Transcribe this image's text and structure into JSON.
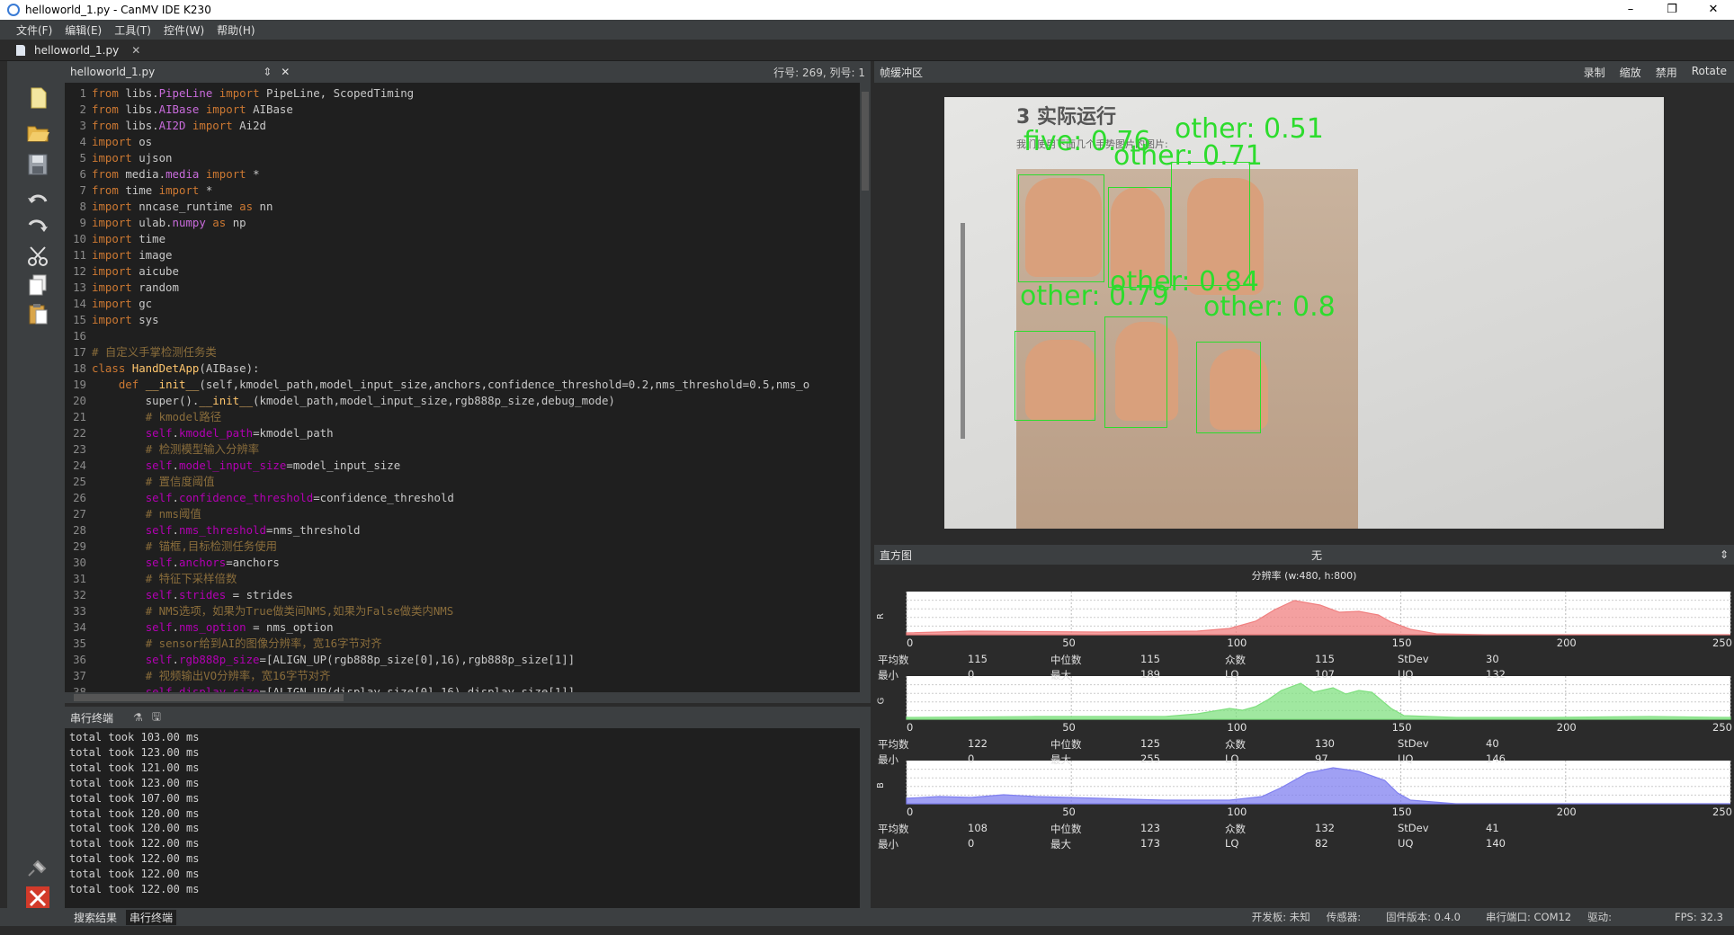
{
  "window": {
    "title": "helloworld_1.py - CanMV IDE K230",
    "minimize": "–",
    "maximize": "❐",
    "close": "✕"
  },
  "menu": [
    "文件(F)",
    "编辑(E)",
    "工具(T)",
    "控件(W)",
    "帮助(H)"
  ],
  "file_tab": {
    "label": "helloworld_1.py",
    "close": "✕"
  },
  "editor": {
    "filename": "helloworld_1.py",
    "switch": "⇕",
    "close": "✕",
    "cursor": "行号: 269, 列号: 1"
  },
  "code": [
    [
      [
        "kw",
        "from "
      ],
      [
        "pl",
        "libs."
      ],
      [
        "cl",
        "PipeLine"
      ],
      [
        "kw",
        " import "
      ],
      [
        "pl",
        "PipeLine, ScopedTiming"
      ]
    ],
    [
      [
        "kw",
        "from "
      ],
      [
        "pl",
        "libs."
      ],
      [
        "cl",
        "AIBase"
      ],
      [
        "kw",
        " import "
      ],
      [
        "pl",
        "AIBase"
      ]
    ],
    [
      [
        "kw",
        "from "
      ],
      [
        "pl",
        "libs."
      ],
      [
        "cl",
        "AI2D"
      ],
      [
        "kw",
        " import "
      ],
      [
        "pl",
        "Ai2d"
      ]
    ],
    [
      [
        "kw",
        "import "
      ],
      [
        "pl",
        "os"
      ]
    ],
    [
      [
        "kw",
        "import "
      ],
      [
        "pl",
        "ujson"
      ]
    ],
    [
      [
        "kw",
        "from "
      ],
      [
        "pl",
        "media."
      ],
      [
        "cl",
        "media"
      ],
      [
        "kw",
        " import "
      ],
      [
        "pl",
        "*"
      ]
    ],
    [
      [
        "kw",
        "from "
      ],
      [
        "pl",
        "time"
      ],
      [
        "kw",
        " import "
      ],
      [
        "pl",
        "*"
      ]
    ],
    [
      [
        "kw",
        "import "
      ],
      [
        "pl",
        "nncase_runtime"
      ],
      [
        "kw",
        " as "
      ],
      [
        "pl",
        "nn"
      ]
    ],
    [
      [
        "kw",
        "import "
      ],
      [
        "pl",
        "ulab."
      ],
      [
        "cl",
        "numpy"
      ],
      [
        "kw",
        " as "
      ],
      [
        "pl",
        "np"
      ]
    ],
    [
      [
        "kw",
        "import "
      ],
      [
        "pl",
        "time"
      ]
    ],
    [
      [
        "kw",
        "import "
      ],
      [
        "pl",
        "image"
      ]
    ],
    [
      [
        "kw",
        "import "
      ],
      [
        "pl",
        "aicube"
      ]
    ],
    [
      [
        "kw",
        "import "
      ],
      [
        "pl",
        "random"
      ]
    ],
    [
      [
        "kw",
        "import "
      ],
      [
        "pl",
        "gc"
      ]
    ],
    [
      [
        "kw",
        "import "
      ],
      [
        "pl",
        "sys"
      ]
    ],
    [
      [
        "pl",
        ""
      ]
    ],
    [
      [
        "cm",
        "# 自定义手掌检测任务类"
      ]
    ],
    [
      [
        "kw",
        "class "
      ],
      [
        "df",
        "HandDetApp"
      ],
      [
        "pl",
        "(AIBase):"
      ]
    ],
    [
      [
        "pl",
        "    "
      ],
      [
        "kw",
        "def "
      ],
      [
        "df",
        "__init__"
      ],
      [
        "pl",
        "(self,kmodel_path,model_input_size,anchors,confidence_threshold=0.2,nms_threshold=0.5,nms_o"
      ]
    ],
    [
      [
        "pl",
        "        super()."
      ],
      [
        "df",
        "__init__"
      ],
      [
        "pl",
        "(kmodel_path,model_input_size,rgb888p_size,debug_mode)"
      ]
    ],
    [
      [
        "pl",
        "        "
      ],
      [
        "cm",
        "# kmodel路径"
      ]
    ],
    [
      [
        "pl",
        "        "
      ],
      [
        "sf",
        "self"
      ],
      [
        "pl",
        "."
      ],
      [
        "sf",
        "kmodel_path"
      ],
      [
        "pl",
        "=kmodel_path"
      ]
    ],
    [
      [
        "pl",
        "        "
      ],
      [
        "cm",
        "# 检测模型输入分辨率"
      ]
    ],
    [
      [
        "pl",
        "        "
      ],
      [
        "sf",
        "self"
      ],
      [
        "pl",
        "."
      ],
      [
        "sf",
        "model_input_size"
      ],
      [
        "pl",
        "=model_input_size"
      ]
    ],
    [
      [
        "pl",
        "        "
      ],
      [
        "cm",
        "# 置信度阈值"
      ]
    ],
    [
      [
        "pl",
        "        "
      ],
      [
        "sf",
        "self"
      ],
      [
        "pl",
        "."
      ],
      [
        "sf",
        "confidence_threshold"
      ],
      [
        "pl",
        "=confidence_threshold"
      ]
    ],
    [
      [
        "pl",
        "        "
      ],
      [
        "cm",
        "# nms阈值"
      ]
    ],
    [
      [
        "pl",
        "        "
      ],
      [
        "sf",
        "self"
      ],
      [
        "pl",
        "."
      ],
      [
        "sf",
        "nms_threshold"
      ],
      [
        "pl",
        "=nms_threshold"
      ]
    ],
    [
      [
        "pl",
        "        "
      ],
      [
        "cm",
        "# 锚框,目标检测任务使用"
      ]
    ],
    [
      [
        "pl",
        "        "
      ],
      [
        "sf",
        "self"
      ],
      [
        "pl",
        "."
      ],
      [
        "sf",
        "anchors"
      ],
      [
        "pl",
        "=anchors"
      ]
    ],
    [
      [
        "pl",
        "        "
      ],
      [
        "cm",
        "# 特征下采样倍数"
      ]
    ],
    [
      [
        "pl",
        "        "
      ],
      [
        "sf",
        "self"
      ],
      [
        "pl",
        "."
      ],
      [
        "sf",
        "strides"
      ],
      [
        "pl",
        " = strides"
      ]
    ],
    [
      [
        "pl",
        "        "
      ],
      [
        "cm",
        "# NMS选项，如果为True做类间NMS,如果为False做类内NMS"
      ]
    ],
    [
      [
        "pl",
        "        "
      ],
      [
        "sf",
        "self"
      ],
      [
        "pl",
        "."
      ],
      [
        "sf",
        "nms_option"
      ],
      [
        "pl",
        " = nms_option"
      ]
    ],
    [
      [
        "pl",
        "        "
      ],
      [
        "cm",
        "# sensor给到AI的图像分辨率，宽16字节对齐"
      ]
    ],
    [
      [
        "pl",
        "        "
      ],
      [
        "sf",
        "self"
      ],
      [
        "pl",
        "."
      ],
      [
        "sf",
        "rgb888p_size"
      ],
      [
        "pl",
        "=[ALIGN_UP(rgb888p_size[0],16),rgb888p_size[1]]"
      ]
    ],
    [
      [
        "pl",
        "        "
      ],
      [
        "cm",
        "# 视频输出VO分辨率，宽16字节对齐"
      ]
    ],
    [
      [
        "pl",
        "        "
      ],
      [
        "sf",
        "self"
      ],
      [
        "pl",
        "."
      ],
      [
        "sf",
        "display_size"
      ],
      [
        "pl",
        "=[ALIGN_UP(display_size[0],16),display_size[1]]"
      ]
    ],
    [
      [
        "pl",
        "        "
      ],
      [
        "cm",
        "# debug模式"
      ]
    ]
  ],
  "terminal": {
    "title": "串行终端",
    "lines": [
      "total took 103.00 ms",
      "total took 123.00 ms",
      "total took 121.00 ms",
      "total took 123.00 ms",
      "total took 107.00 ms",
      "total took 120.00 ms",
      "total took 120.00 ms",
      "total took 122.00 ms",
      "total took 122.00 ms",
      "total took 122.00 ms",
      "total took 122.00 ms"
    ]
  },
  "bottom_tabs": [
    "搜索结果",
    "串行终端"
  ],
  "status": {
    "board": "开发板: 未知",
    "sensor": "传感器:",
    "firmware": "固件版本: 0.4.0",
    "port": "串行端口: COM12",
    "driver": "驱动:",
    "fps": "FPS:  32.3"
  },
  "framebuffer": {
    "title": "帧缓冲区",
    "actions": [
      "录制",
      "缩放",
      "禁用",
      "Rotate"
    ],
    "doc_heading": "3 实际运行",
    "doc_sub": "我们使用下面几个手势图片的图片:",
    "detections": [
      {
        "label": "five: 0.76"
      },
      {
        "label": "other: 0.71"
      },
      {
        "label": "other: 0.51"
      },
      {
        "label": "other: 0.79"
      },
      {
        "label": "other: 0.84"
      },
      {
        "label": "other: 0.8"
      }
    ]
  },
  "histogram": {
    "title": "直方图",
    "mode": "无",
    "resolution": "分辨率 (w:480, h:800)",
    "x_ticks": [
      "0",
      "50",
      "100",
      "150",
      "200",
      "250"
    ],
    "stat_labels": [
      "平均数",
      "中位数",
      "众数",
      "StDev",
      "最小",
      "最大",
      "LQ",
      "UQ"
    ],
    "channels": [
      {
        "name": "R",
        "color": "#f08080",
        "mean": "115",
        "median": "115",
        "mode": "115",
        "stdev": "30",
        "min": "0",
        "max": "189",
        "lq": "107",
        "uq": "132"
      },
      {
        "name": "G",
        "color": "#80e080",
        "mean": "122",
        "median": "125",
        "mode": "130",
        "stdev": "40",
        "min": "0",
        "max": "255",
        "lq": "97",
        "uq": "146"
      },
      {
        "name": "B",
        "color": "#8080f0",
        "mean": "108",
        "median": "123",
        "mode": "132",
        "stdev": "41",
        "min": "0",
        "max": "173",
        "lq": "82",
        "uq": "140"
      }
    ]
  }
}
